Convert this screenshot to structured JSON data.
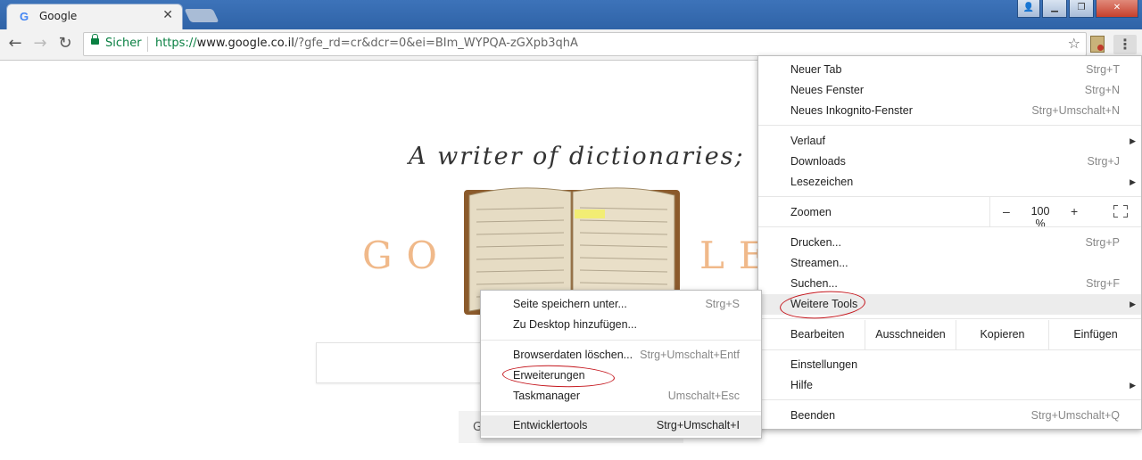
{
  "browser": {
    "tab": {
      "favicon": "G",
      "title": "Google"
    },
    "window_buttons": [
      "user-icon",
      "minimize-icon",
      "restore-icon",
      "close-icon"
    ]
  },
  "toolbar": {
    "secure_label": "Sicher",
    "url_scheme": "https://",
    "url_host": "www.google.co.il",
    "url_rest": "/?gfe_rd=cr&dcr=0&ei=BIm_WYPQA-zGXpb3qhA"
  },
  "page": {
    "doodle_tagline": "A writer of dictionaries;",
    "doodle_left": "GO",
    "doodle_right": "LE",
    "button_partial": "G"
  },
  "main_menu": {
    "items": [
      {
        "label": "Neuer Tab",
        "shortcut": "Strg+T"
      },
      {
        "label": "Neues Fenster",
        "shortcut": "Strg+N"
      },
      {
        "label": "Neues Inkognito-Fenster",
        "shortcut": "Strg+Umschalt+N"
      },
      {
        "label": "Verlauf",
        "shortcut": ""
      },
      {
        "label": "Downloads",
        "shortcut": "Strg+J"
      },
      {
        "label": "Lesezeichen",
        "shortcut": ""
      },
      {
        "label": "Drucken...",
        "shortcut": "Strg+P"
      },
      {
        "label": "Streamen...",
        "shortcut": ""
      },
      {
        "label": "Suchen...",
        "shortcut": "Strg+F"
      },
      {
        "label": "Weitere Tools",
        "shortcut": ""
      },
      {
        "label": "Einstellungen",
        "shortcut": ""
      },
      {
        "label": "Hilfe",
        "shortcut": ""
      },
      {
        "label": "Beenden",
        "shortcut": "Strg+Umschalt+Q"
      }
    ],
    "zoom": {
      "label": "Zoomen",
      "minus": "–",
      "value": "100 %",
      "plus": "+"
    },
    "edit": {
      "label": "Bearbeiten",
      "cut": "Ausschneiden",
      "copy": "Kopieren",
      "paste": "Einfügen"
    }
  },
  "sub_menu": {
    "items": [
      {
        "label": "Seite speichern unter...",
        "shortcut": "Strg+S"
      },
      {
        "label": "Zu Desktop hinzufügen...",
        "shortcut": ""
      },
      {
        "label": "Browserdaten löschen...",
        "shortcut": "Strg+Umschalt+Entf"
      },
      {
        "label": "Erweiterungen",
        "shortcut": ""
      },
      {
        "label": "Taskmanager",
        "shortcut": "Umschalt+Esc"
      },
      {
        "label": "Entwicklertools",
        "shortcut": "Strg+Umschalt+I"
      }
    ]
  },
  "colors": {
    "titlebar": "#3d73b9",
    "secure_green": "#0b8043",
    "annotation_red": "#c4151c",
    "doodle_orange": "#f0b98a"
  }
}
